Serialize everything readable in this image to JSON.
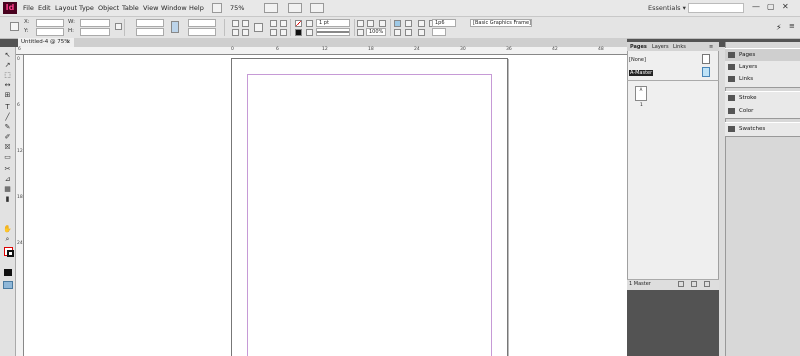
{
  "app": {
    "logo": "Id"
  },
  "menu": {
    "items": [
      "File",
      "Edit",
      "Layout",
      "Type",
      "Object",
      "Table",
      "View",
      "Window",
      "Help"
    ],
    "zoom": "75%",
    "workspace": "Essentials",
    "workspace_arrow": "▾"
  },
  "window_controls": {
    "minimize": "—",
    "maximize": "▢",
    "close": "✕"
  },
  "control": {
    "x_label": "X:",
    "y_label": "Y:",
    "w_label": "W:",
    "h_label": "H:",
    "stroke_weight": "1 pt",
    "opacity": "100%",
    "fit_value": "1p6",
    "object_style": "[Basic Graphics Frame]"
  },
  "document": {
    "tab_title": "Untitled-4 @ 75%",
    "tab_close": "×"
  },
  "ruler": {
    "h_ticks": [
      "6",
      "0",
      "6",
      "12",
      "18",
      "24",
      "30",
      "36",
      "42",
      "48"
    ],
    "v_ticks": [
      "0",
      "6",
      "12",
      "18",
      "24"
    ]
  },
  "tools": [
    "↖",
    "↗",
    "⬚",
    "↔",
    "⊞",
    "T",
    "╱",
    "✎",
    "✐",
    "☒",
    "▭",
    "✂",
    "⊿",
    "▦",
    "▮",
    "✋",
    "⌕"
  ],
  "pages_panel": {
    "tabs": [
      "Pages",
      "Layers",
      "Links"
    ],
    "menu_icon": "≡",
    "none_label": "[None]",
    "master_label": "A-Master",
    "page_letter": "A",
    "page_number": "1",
    "footer_text": "1 Master"
  },
  "dock": {
    "items": [
      "Pages",
      "Layers",
      "Links",
      "Stroke",
      "Color",
      "Swatches"
    ]
  }
}
